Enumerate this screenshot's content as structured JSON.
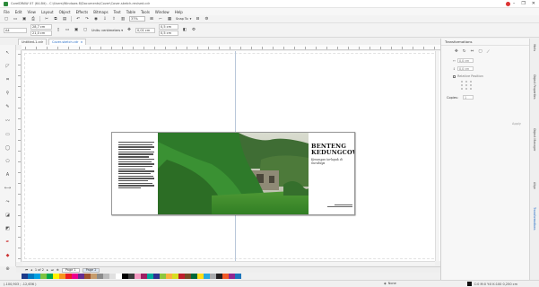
{
  "window": {
    "title": "CorelDRAW X7 (64-Bit) - C:\\Users\\Windows 8\\Documents\\Cover\\Cover-sketch-revised.cdr",
    "minimize": "–",
    "maximize": "❐",
    "close": "✕"
  },
  "menu": [
    "File",
    "Edit",
    "View",
    "Layout",
    "Object",
    "Effects",
    "Bitmaps",
    "Text",
    "Table",
    "Tools",
    "Window",
    "Help"
  ],
  "toolbar1": {
    "zoom": "37%",
    "snap_label": "Snap To"
  },
  "toolbar2": {
    "page_size": "A4",
    "width": "28,7 cm",
    "height": "21,0 cm",
    "units_label": "Units: centimeters",
    "nudge": "0,01 cm",
    "dup_x": "0,5 cm",
    "dup_y": "0,5 cm"
  },
  "tabs": [
    {
      "label": "Untitled-1.cdr"
    },
    {
      "label": "Cover-sketch.cdr"
    }
  ],
  "artwork": {
    "title_line1": "BENTENG",
    "title_line2": "KEDUNGCOWEK",
    "subtitle": "Kenangan terlupak di Surabaya"
  },
  "pagebar": {
    "position": "1 of 2",
    "pages": [
      "Page 1",
      "Page 2"
    ]
  },
  "palette": [
    "#1d3a8a",
    "#0078c1",
    "#00a0e0",
    "#7fc241",
    "#00a650",
    "#fff200",
    "#f7941d",
    "#ed1c24",
    "#ec008c",
    "#662d91",
    "#a0522d",
    "#c69c6d",
    "#8b8b8b",
    "#bcbcbc",
    "#e0e0e0",
    "#ffffff",
    "#000000",
    "#3b3b3b",
    "#f49ac2",
    "#9e1f63",
    "#00a99d",
    "#2e3192",
    "#8dc63f",
    "#fbb040",
    "#d7df23",
    "#be1e2d",
    "#754c24",
    "#006838",
    "#ffde17",
    "#27aae1",
    "#a7a9ac",
    "#231f20",
    "#f15a29",
    "#92278f",
    "#1c75bc"
  ],
  "status": {
    "left": "(-100,903 ; -12,636 )",
    "fill_label": "None",
    "right": "C:0 M:0 Y:0 K:100  0,250 cm"
  },
  "docker": {
    "title": "Transformations",
    "x_value": "0,0 cm",
    "y_value": "0,0 cm",
    "relative_label": "Relative Position",
    "copies_label": "Copies:",
    "copies_value": "1",
    "apply_label": "Apply"
  },
  "side_tabs": [
    "Hints",
    "Object Properties",
    "Object Manager",
    "Align",
    "Transformations"
  ]
}
